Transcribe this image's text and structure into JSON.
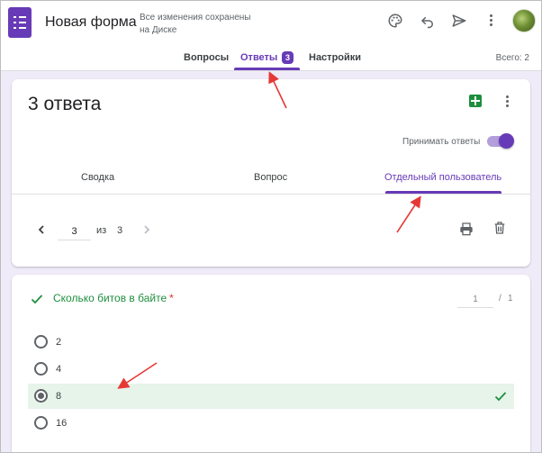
{
  "header": {
    "title": "Новая форма",
    "save_status": "Все изменения сохранены на Диске",
    "icons": [
      "palette-icon",
      "undo-icon",
      "send-icon",
      "more-vert-icon"
    ]
  },
  "tabs": {
    "items": [
      {
        "label": "Вопросы"
      },
      {
        "label": "Ответы",
        "badge": "3",
        "active": true
      },
      {
        "label": "Настройки"
      }
    ],
    "total": "Всего: 2"
  },
  "responses": {
    "count_label": "3 ответа",
    "accept_label": "Принимать ответы",
    "accepting": true,
    "subtabs": [
      {
        "label": "Сводка"
      },
      {
        "label": "Вопрос"
      },
      {
        "label": "Отдельный пользователь",
        "active": true
      }
    ],
    "pager": {
      "current": "3",
      "of_label": "из",
      "total": "3"
    }
  },
  "question": {
    "title": "Сколько битов в байте",
    "required_mark": "*",
    "score": "1",
    "score_separator": "/",
    "score_max": "1",
    "options": [
      {
        "label": "2",
        "selected": false,
        "correct": false
      },
      {
        "label": "4",
        "selected": false,
        "correct": false
      },
      {
        "label": "8",
        "selected": true,
        "correct": true
      },
      {
        "label": "16",
        "selected": false,
        "correct": false
      }
    ]
  },
  "colors": {
    "accent": "#673ab7",
    "correct_green": "#1e8e3e",
    "correct_bg": "#e6f4ea",
    "annotation_red": "#e53935"
  }
}
